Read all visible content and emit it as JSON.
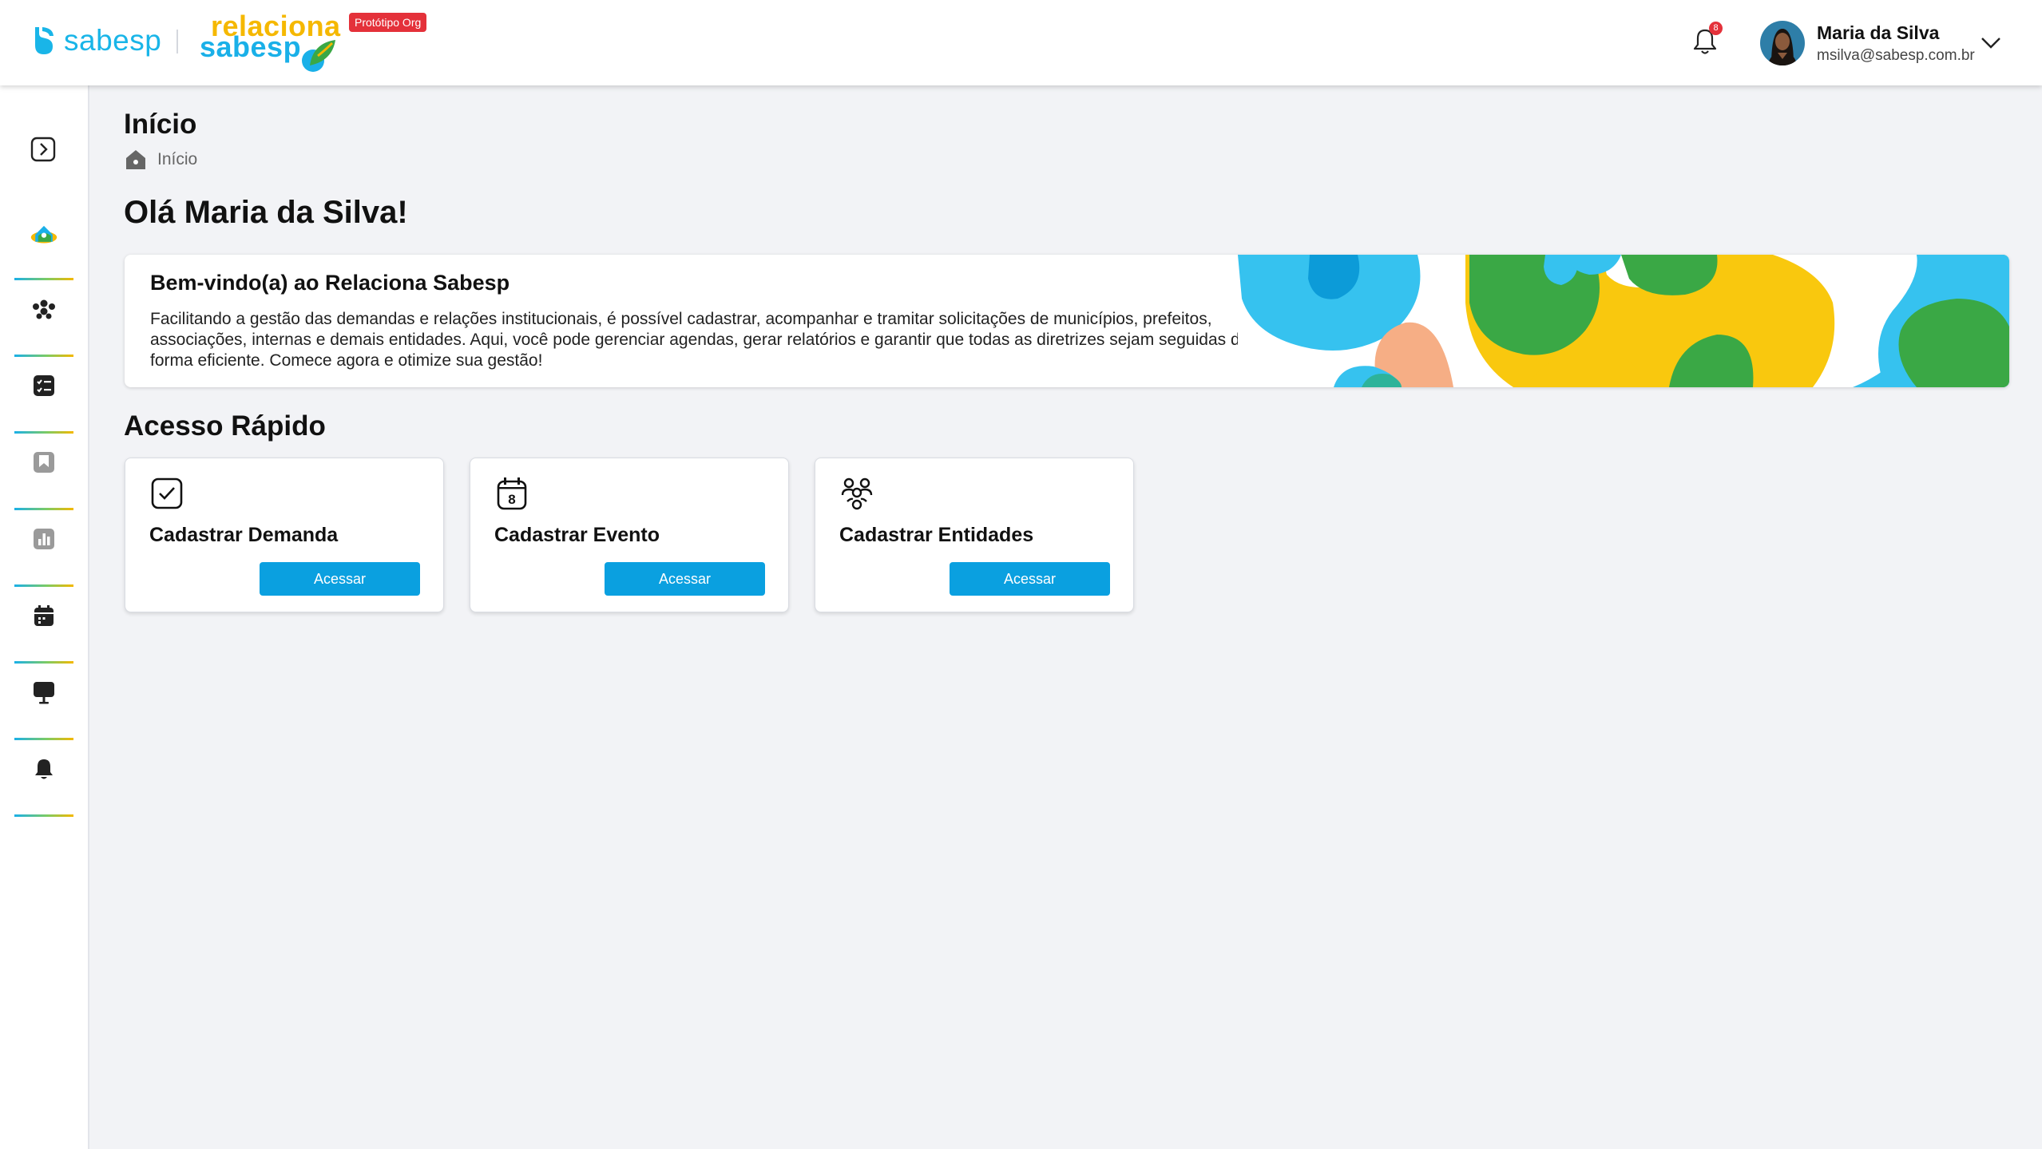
{
  "header": {
    "logo_word": "sabesp",
    "relaciona_top": "relaciona",
    "relaciona_bottom": "sabesp",
    "badge": "Protótipo Org",
    "notifications_count": "8",
    "user_name": "Maria da Silva",
    "user_email": "msilva@sabesp.com.br"
  },
  "sidebar": {
    "items": [
      {
        "icon": "home-icon",
        "active": true
      },
      {
        "icon": "people-icon"
      },
      {
        "icon": "checklist-icon"
      },
      {
        "icon": "bookmark-icon"
      },
      {
        "icon": "chart-icon"
      },
      {
        "icon": "calendar-icon"
      },
      {
        "icon": "monitor-icon"
      },
      {
        "icon": "bell-icon"
      }
    ]
  },
  "page": {
    "title": "Início",
    "breadcrumb": "Início",
    "greeting": "Olá Maria da Silva!"
  },
  "welcome": {
    "title": "Bem-vindo(a) ao Relaciona Sabesp",
    "text": "Facilitando a gestão das demandas e relações institucionais, é possível cadastrar, acompanhar e tramitar solicitações de municípios, prefeitos, associações, internas e demais entidades. Aqui, você pode gerenciar agendas, gerar relatórios e garantir que todas as diretrizes sejam seguidas de forma eficiente. Comece agora e otimize sua gestão!"
  },
  "quick_access": {
    "title": "Acesso Rápido",
    "cards": [
      {
        "title": "Cadastrar Demanda",
        "button": "Acessar",
        "icon": "check-square-icon"
      },
      {
        "title": "Cadastrar Evento",
        "button": "Acessar",
        "icon": "calendar-icon",
        "icon_number": "8"
      },
      {
        "title": "Cadastrar Entidades",
        "button": "Acessar",
        "icon": "people-group-icon"
      }
    ]
  },
  "colors": {
    "brand_blue": "#1ab0e8",
    "brand_yellow": "#f5b800",
    "brand_green": "#3aa845",
    "button": "#0aa0e0",
    "badge_red": "#e4313a"
  }
}
